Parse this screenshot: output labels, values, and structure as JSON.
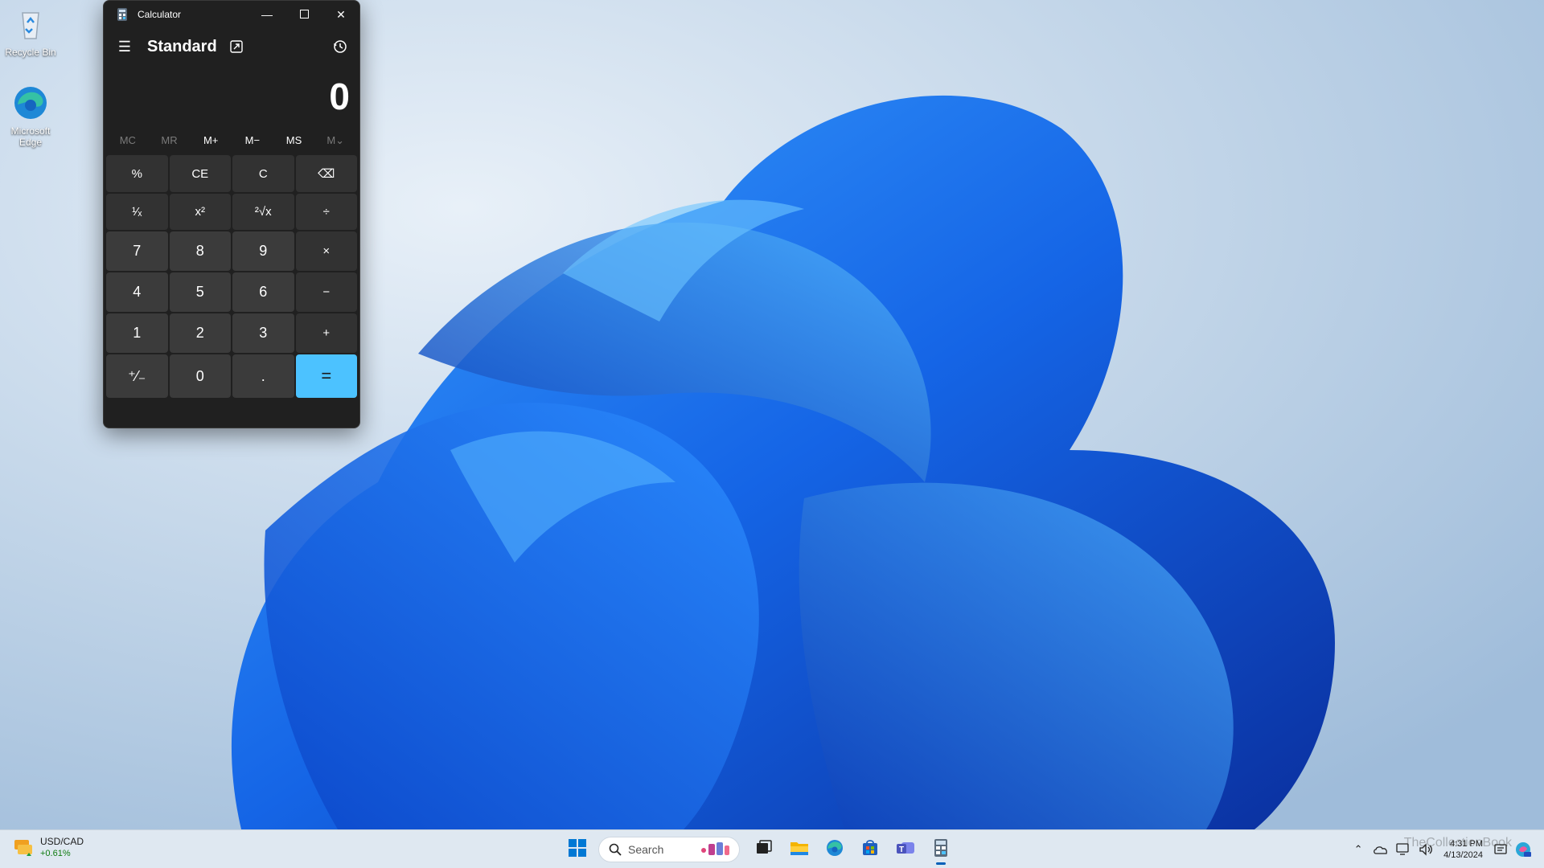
{
  "desktop": {
    "icons": [
      {
        "label": "Recycle Bin"
      },
      {
        "label": "Microsoft Edge"
      }
    ]
  },
  "calculator": {
    "window_title": "Calculator",
    "mode": "Standard",
    "display_value": "0",
    "memory_buttons": [
      "MC",
      "MR",
      "M+",
      "M−",
      "MS",
      "M⌄"
    ],
    "keys": [
      [
        "%",
        "CE",
        "C",
        "⌫"
      ],
      [
        "¹⁄ₓ",
        "x²",
        "²√x",
        "÷"
      ],
      [
        "7",
        "8",
        "9",
        "×"
      ],
      [
        "4",
        "5",
        "6",
        "−"
      ],
      [
        "1",
        "2",
        "3",
        "+"
      ],
      [
        "⁺⁄₋",
        "0",
        ".",
        "="
      ]
    ],
    "accent_color": "#4cc2ff"
  },
  "taskbar": {
    "widget": {
      "title": "USD/CAD",
      "change": "+0.61%"
    },
    "search_placeholder": "Search",
    "apps": [
      "start-icon",
      "task-view-icon",
      "file-explorer-icon",
      "edge-icon",
      "store-icon",
      "teams-icon",
      "calculator-icon"
    ],
    "clock": {
      "time": "4:31 PM",
      "date": "4/13/2024"
    }
  },
  "watermark": "TheCollectionBook"
}
